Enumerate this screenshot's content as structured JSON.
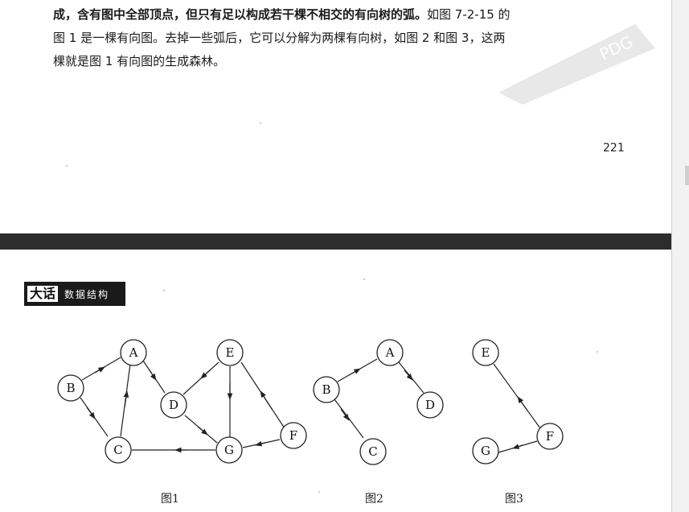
{
  "top_page": {
    "lines": [
      {
        "bold": "成，含有图中全部顶点，但只有足以构成若干棵不相交的有向树的弧。",
        "normal": "如图 7-2-15 的"
      },
      {
        "bold": "",
        "normal": "图 1 是一棵有向图。去掉一些弧后，它可以分解为两棵有向树，如图 2 和图 3，这两"
      },
      {
        "bold": "",
        "normal": "棵就是图 1 有向图的生成森林。"
      }
    ],
    "page_number": "221",
    "watermark_text": "PDG"
  },
  "bottom_page": {
    "header_logo": "大话",
    "header_sub": "数据结构",
    "figures": [
      {
        "caption": "图1",
        "nodes": [
          "A",
          "B",
          "C",
          "D",
          "E",
          "F",
          "G"
        ],
        "edges": [
          [
            "B",
            "A"
          ],
          [
            "A",
            "D"
          ],
          [
            "B",
            "C"
          ],
          [
            "C",
            "A"
          ],
          [
            "E",
            "D"
          ],
          [
            "E",
            "G"
          ],
          [
            "D",
            "G"
          ],
          [
            "F",
            "E"
          ],
          [
            "F",
            "G"
          ],
          [
            "G",
            "C"
          ]
        ]
      },
      {
        "caption": "图2",
        "nodes": [
          "A",
          "B",
          "C",
          "D"
        ],
        "edges": [
          [
            "B",
            "A"
          ],
          [
            "A",
            "D"
          ],
          [
            "B",
            "C"
          ]
        ]
      },
      {
        "caption": "图3",
        "nodes": [
          "E",
          "F",
          "G"
        ],
        "edges": [
          [
            "F",
            "E"
          ],
          [
            "F",
            "G"
          ]
        ]
      }
    ]
  }
}
